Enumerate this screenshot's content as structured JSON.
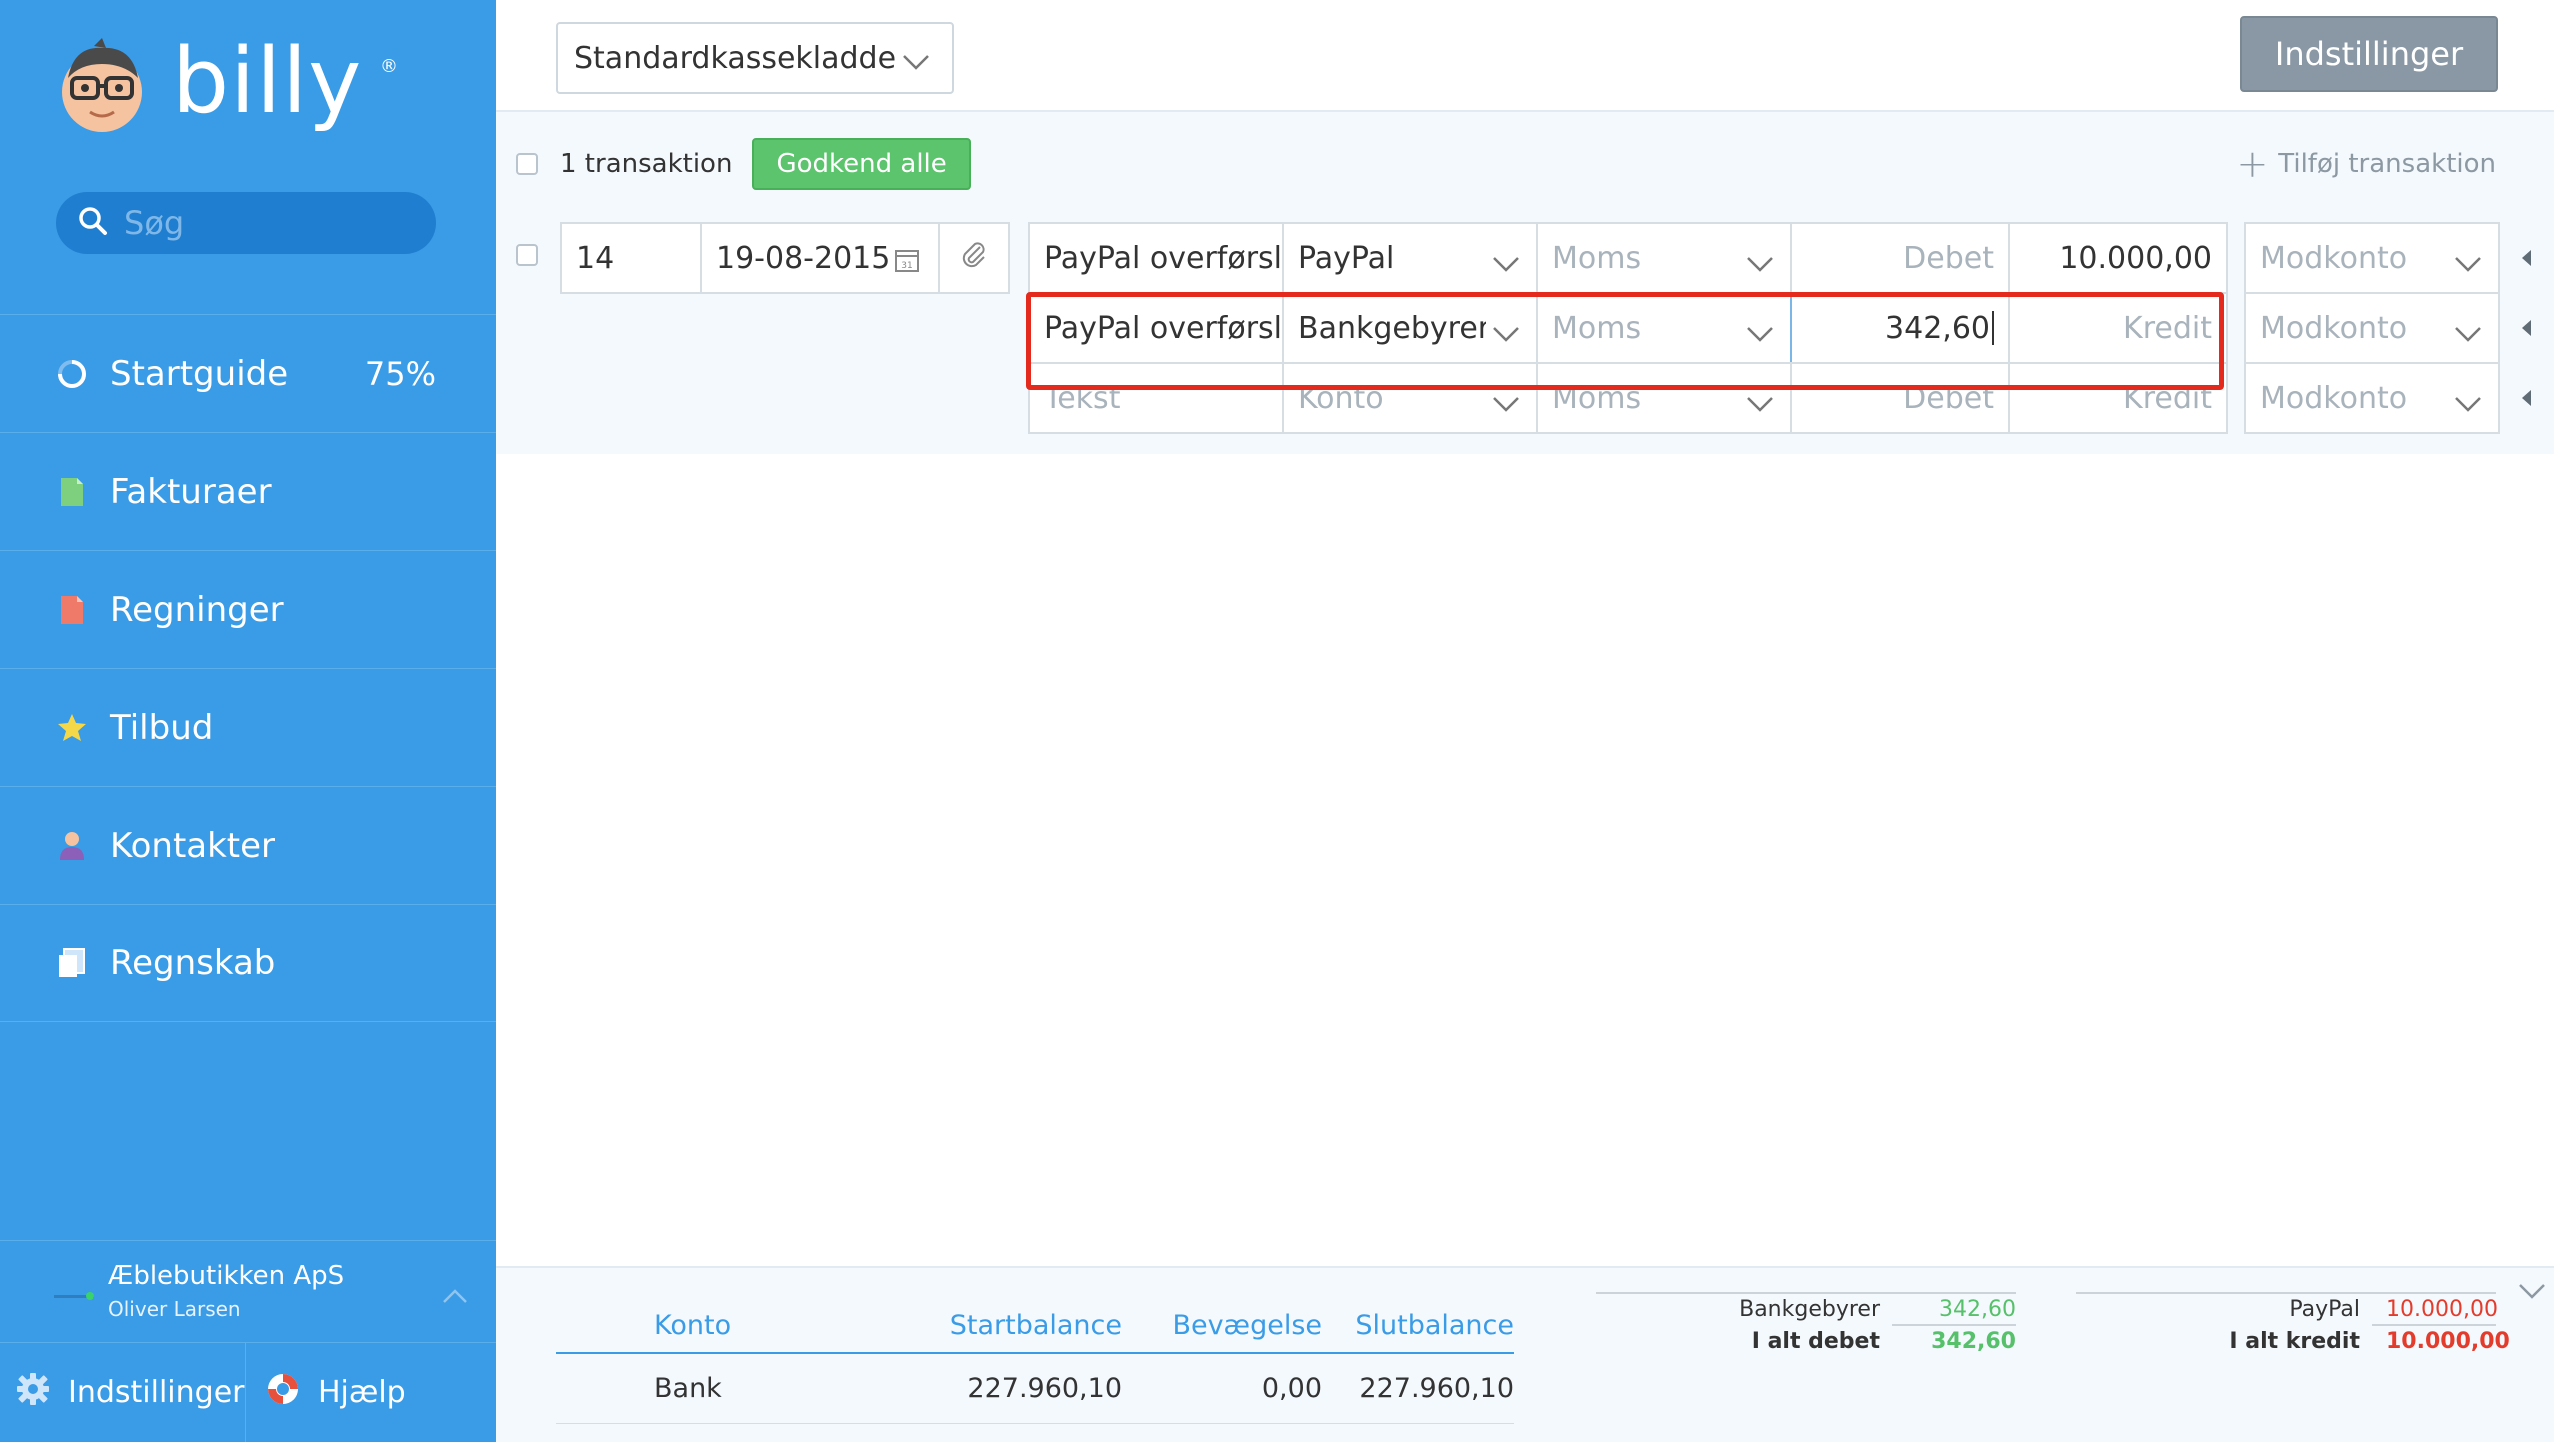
{
  "app": {
    "logo_text": "billy",
    "logo_mark": "®",
    "search_placeholder": "Søg"
  },
  "sidebar": {
    "items": [
      {
        "label": "Startguide",
        "icon": "progress-ring-icon",
        "badge": "75%"
      },
      {
        "label": "Fakturaer",
        "icon": "invoice-document-icon",
        "icon_color": "#7ed07e"
      },
      {
        "label": "Regninger",
        "icon": "bill-document-icon",
        "icon_color": "#f07a6a"
      },
      {
        "label": "Tilbud",
        "icon": "star-icon",
        "icon_color": "#f5d84a"
      },
      {
        "label": "Kontakter",
        "icon": "person-icon",
        "icon_color": "#8c5fb8"
      },
      {
        "label": "Regnskab",
        "icon": "ledger-icon",
        "icon_color": "#ffffff"
      }
    ],
    "company": {
      "name": "Æblebutikken ApS",
      "user": "Oliver Larsen"
    },
    "bottom": {
      "settings_label": "Indstillinger",
      "help_label": "Hjælp"
    }
  },
  "toolbar": {
    "journal": "Standardkassekladde",
    "settings_label": "Indstillinger"
  },
  "transactions": {
    "count_label": "1 transaktion",
    "approve_all_label": "Godkend alle",
    "add_label": "Tilføj transaktion",
    "entry": {
      "voucher_no": "14",
      "date": "19-08-2015",
      "lines": [
        {
          "text": "PayPal overførsle",
          "account": "PayPal",
          "vat": "Moms",
          "debit": "",
          "credit": "10.000,00",
          "contra": "Modkonto"
        },
        {
          "text": "PayPal overførsle",
          "account": "Bankgebyrer",
          "vat": "Moms",
          "debit": "342,60",
          "credit": "",
          "contra": "Modkonto"
        },
        {
          "text": "",
          "account": "",
          "vat": "Moms",
          "debit": "",
          "credit": "",
          "contra": "Modkonto"
        }
      ],
      "placeholders": {
        "text": "Tekst",
        "account": "Konto",
        "vat": "Moms",
        "debit": "Debet",
        "credit": "Kredit",
        "contra": "Modkonto"
      }
    }
  },
  "balance": {
    "headers": [
      "Konto",
      "Startbalance",
      "Bevægelse",
      "Slutbalance"
    ],
    "rows": [
      {
        "account": "Bank",
        "start": "227.960,10",
        "movement": "0,00",
        "end": "227.960,10"
      }
    ]
  },
  "totals": {
    "debit": {
      "account": "Bankgebyrer",
      "account_value": "342,60",
      "total_label": "I alt debet",
      "total_value": "342,60"
    },
    "credit": {
      "account": "PayPal",
      "account_value": "10.000,00",
      "total_label": "I alt kredit",
      "total_value": "10.000,00"
    }
  },
  "colors": {
    "sidebar_bg": "#3a9be6",
    "approve_green": "#5cc46c",
    "highlight_red": "#e42a1d",
    "debit_green": "#56c06a",
    "credit_red": "#e43c2c"
  }
}
